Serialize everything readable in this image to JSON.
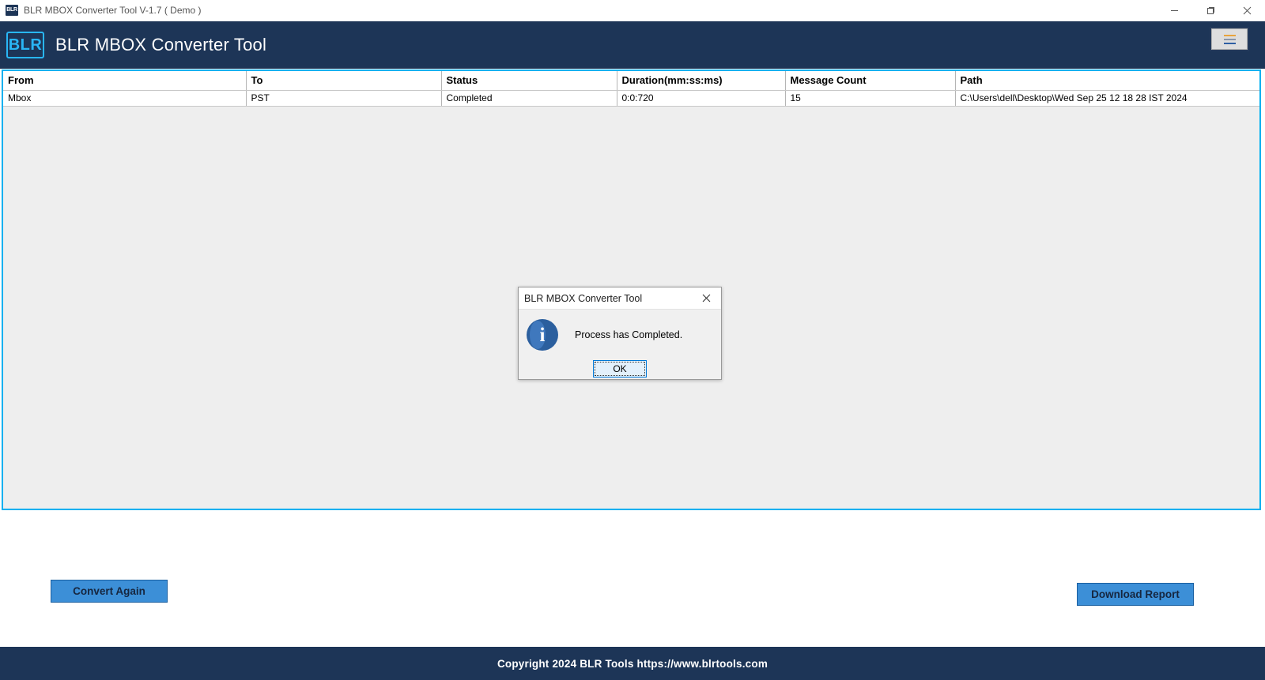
{
  "window": {
    "title": "BLR MBOX Converter Tool V-1.7 ( Demo )",
    "logo_text": "BLR",
    "controls": {
      "minimize": "minimize-icon",
      "maximize": "maximize-icon",
      "close": "close-icon"
    }
  },
  "header": {
    "logo_text": "BLR",
    "title": "BLR MBOX Converter Tool",
    "menu_button_icon": "hamburger-menu-icon"
  },
  "table": {
    "columns": [
      "From",
      "To",
      "Status",
      "Duration(mm:ss:ms)",
      "Message Count",
      "Path"
    ],
    "rows": [
      {
        "from": "Mbox",
        "to": "PST",
        "status": "Completed",
        "duration": "0:0:720",
        "message_count": "15",
        "path": "C:\\Users\\dell\\Desktop\\Wed Sep 25 12 18 28 IST 2024"
      }
    ]
  },
  "dialog": {
    "title": "BLR MBOX Converter Tool",
    "close_icon": "close-icon",
    "info_icon": "info-icon",
    "info_glyph": "i",
    "message": "Process has Completed.",
    "ok_label": "OK"
  },
  "actions": {
    "convert_again_label": "Convert Again",
    "download_report_label": "Download Report"
  },
  "footer": {
    "text": "Copyright 2024 BLR Tools https://www.blrtools.com"
  },
  "colors": {
    "header_bg": "#1d3557",
    "panel_border": "#00b0f0",
    "panel_bg": "#eeeeee",
    "button_blue": "#3c8fd7",
    "accent_cyan": "#29b6f6",
    "info_blue": "#2b5f9e"
  }
}
